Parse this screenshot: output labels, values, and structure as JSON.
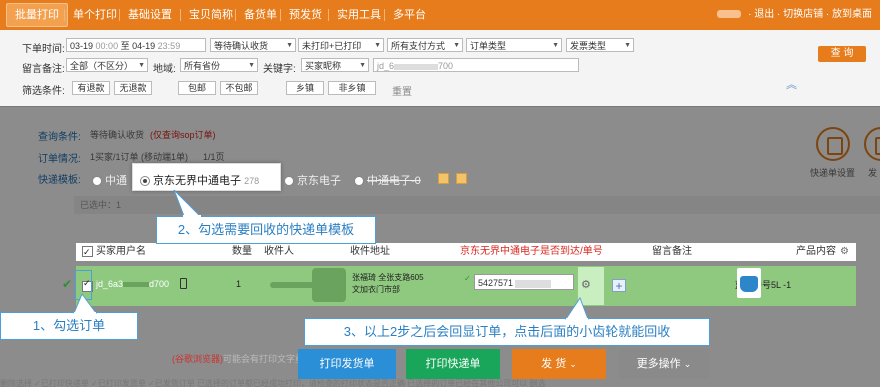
{
  "nav": {
    "tabs": [
      "批量打印",
      "单个打印",
      "基础设置",
      "宝贝简称",
      "备货单",
      "预发货",
      "实用工具",
      "多平台"
    ],
    "right_links": [
      "退出",
      "切换店铺",
      "放到桌面"
    ]
  },
  "filter": {
    "order_time_label": "下单时间:",
    "date_from": "03-19",
    "time_from": "00:00",
    "to_word": "至",
    "date_to": "04-19",
    "time_to": "23:59",
    "status_select": "等待确认收货",
    "print_select": "未打印+已打印",
    "pay_select": "所有支付方式",
    "order_type_select": "订单类型",
    "ship_type_select": "发票类型",
    "remark_label": "留言备注:",
    "remark_select": "全部（不区分）",
    "region_label": "地域:",
    "region_select": "所有省份",
    "keyword_label": "关键字:",
    "keyword_select": "买家昵称",
    "keyword_value": "jd_6",
    "keyword_value_tail": "700",
    "filter_label": "筛选条件:",
    "filter_buttons": [
      "有退款",
      "无退款",
      "包邮",
      "不包邮",
      "乡镇",
      "非乡镇"
    ],
    "reset": "重置",
    "search_button": "查 询"
  },
  "info": {
    "query_label": "查询条件:",
    "query_value": "等待确认收货",
    "query_link": "(仅查询sop订单)",
    "order_label": "订单情况:",
    "order_value": "1买家/1订单 (移动端1单)",
    "page_value": "1/1页",
    "template_label": "快递模板:",
    "templates": [
      "中通",
      "京东无界中通电子",
      "京东电子",
      "中通电子"
    ],
    "template_count": "278",
    "template_suffix": "-0",
    "selected_text": "已选中：1",
    "tool_labels": [
      "快递单设置",
      "发"
    ]
  },
  "table": {
    "headers": [
      "买家用户名",
      "数量",
      "收件人",
      "收件地址",
      "京东无界中通电子是否到达/单号",
      "留言备注",
      "产品内容"
    ],
    "row": {
      "buyer": "jd_6a3",
      "buyer_tail": "d700",
      "quantity": "1",
      "address_line1": "张福琦  全张支路605",
      "address_line2": "文加衣门市部",
      "waybill": "5427571",
      "product": "蓝色中号5L  -1"
    }
  },
  "callouts": {
    "step1": "1、勾选订单",
    "step2": "2、勾选需要回收的快递单模板",
    "step3": "3、以上2步之后会回显订单，点击后面的小齿轮就能回收"
  },
  "bottom": {
    "note_prefix": "(谷歌浏览器)",
    "note": "可能会有打印文字重叠",
    "buttons": [
      "打印发货单",
      "打印快递单",
      "发 货",
      "更多操作"
    ],
    "strip": "删除选择   ✓已打印快递单   ✓已打印发货单   ✓已发货订单   已选择的订单都已经成功打印，请检查的打印状态是否正确 已选择的订单已经在其他公司可以   删选"
  },
  "colors": {
    "brand_orange": "#e67c1b",
    "row_green": "#8ec97f",
    "callout_blue": "#4d9fd8",
    "btn_blue": "#2a8fd6",
    "btn_green": "#19a65a",
    "btn_orange": "#e67c1b",
    "btn_gray": "#8a8a8a"
  }
}
